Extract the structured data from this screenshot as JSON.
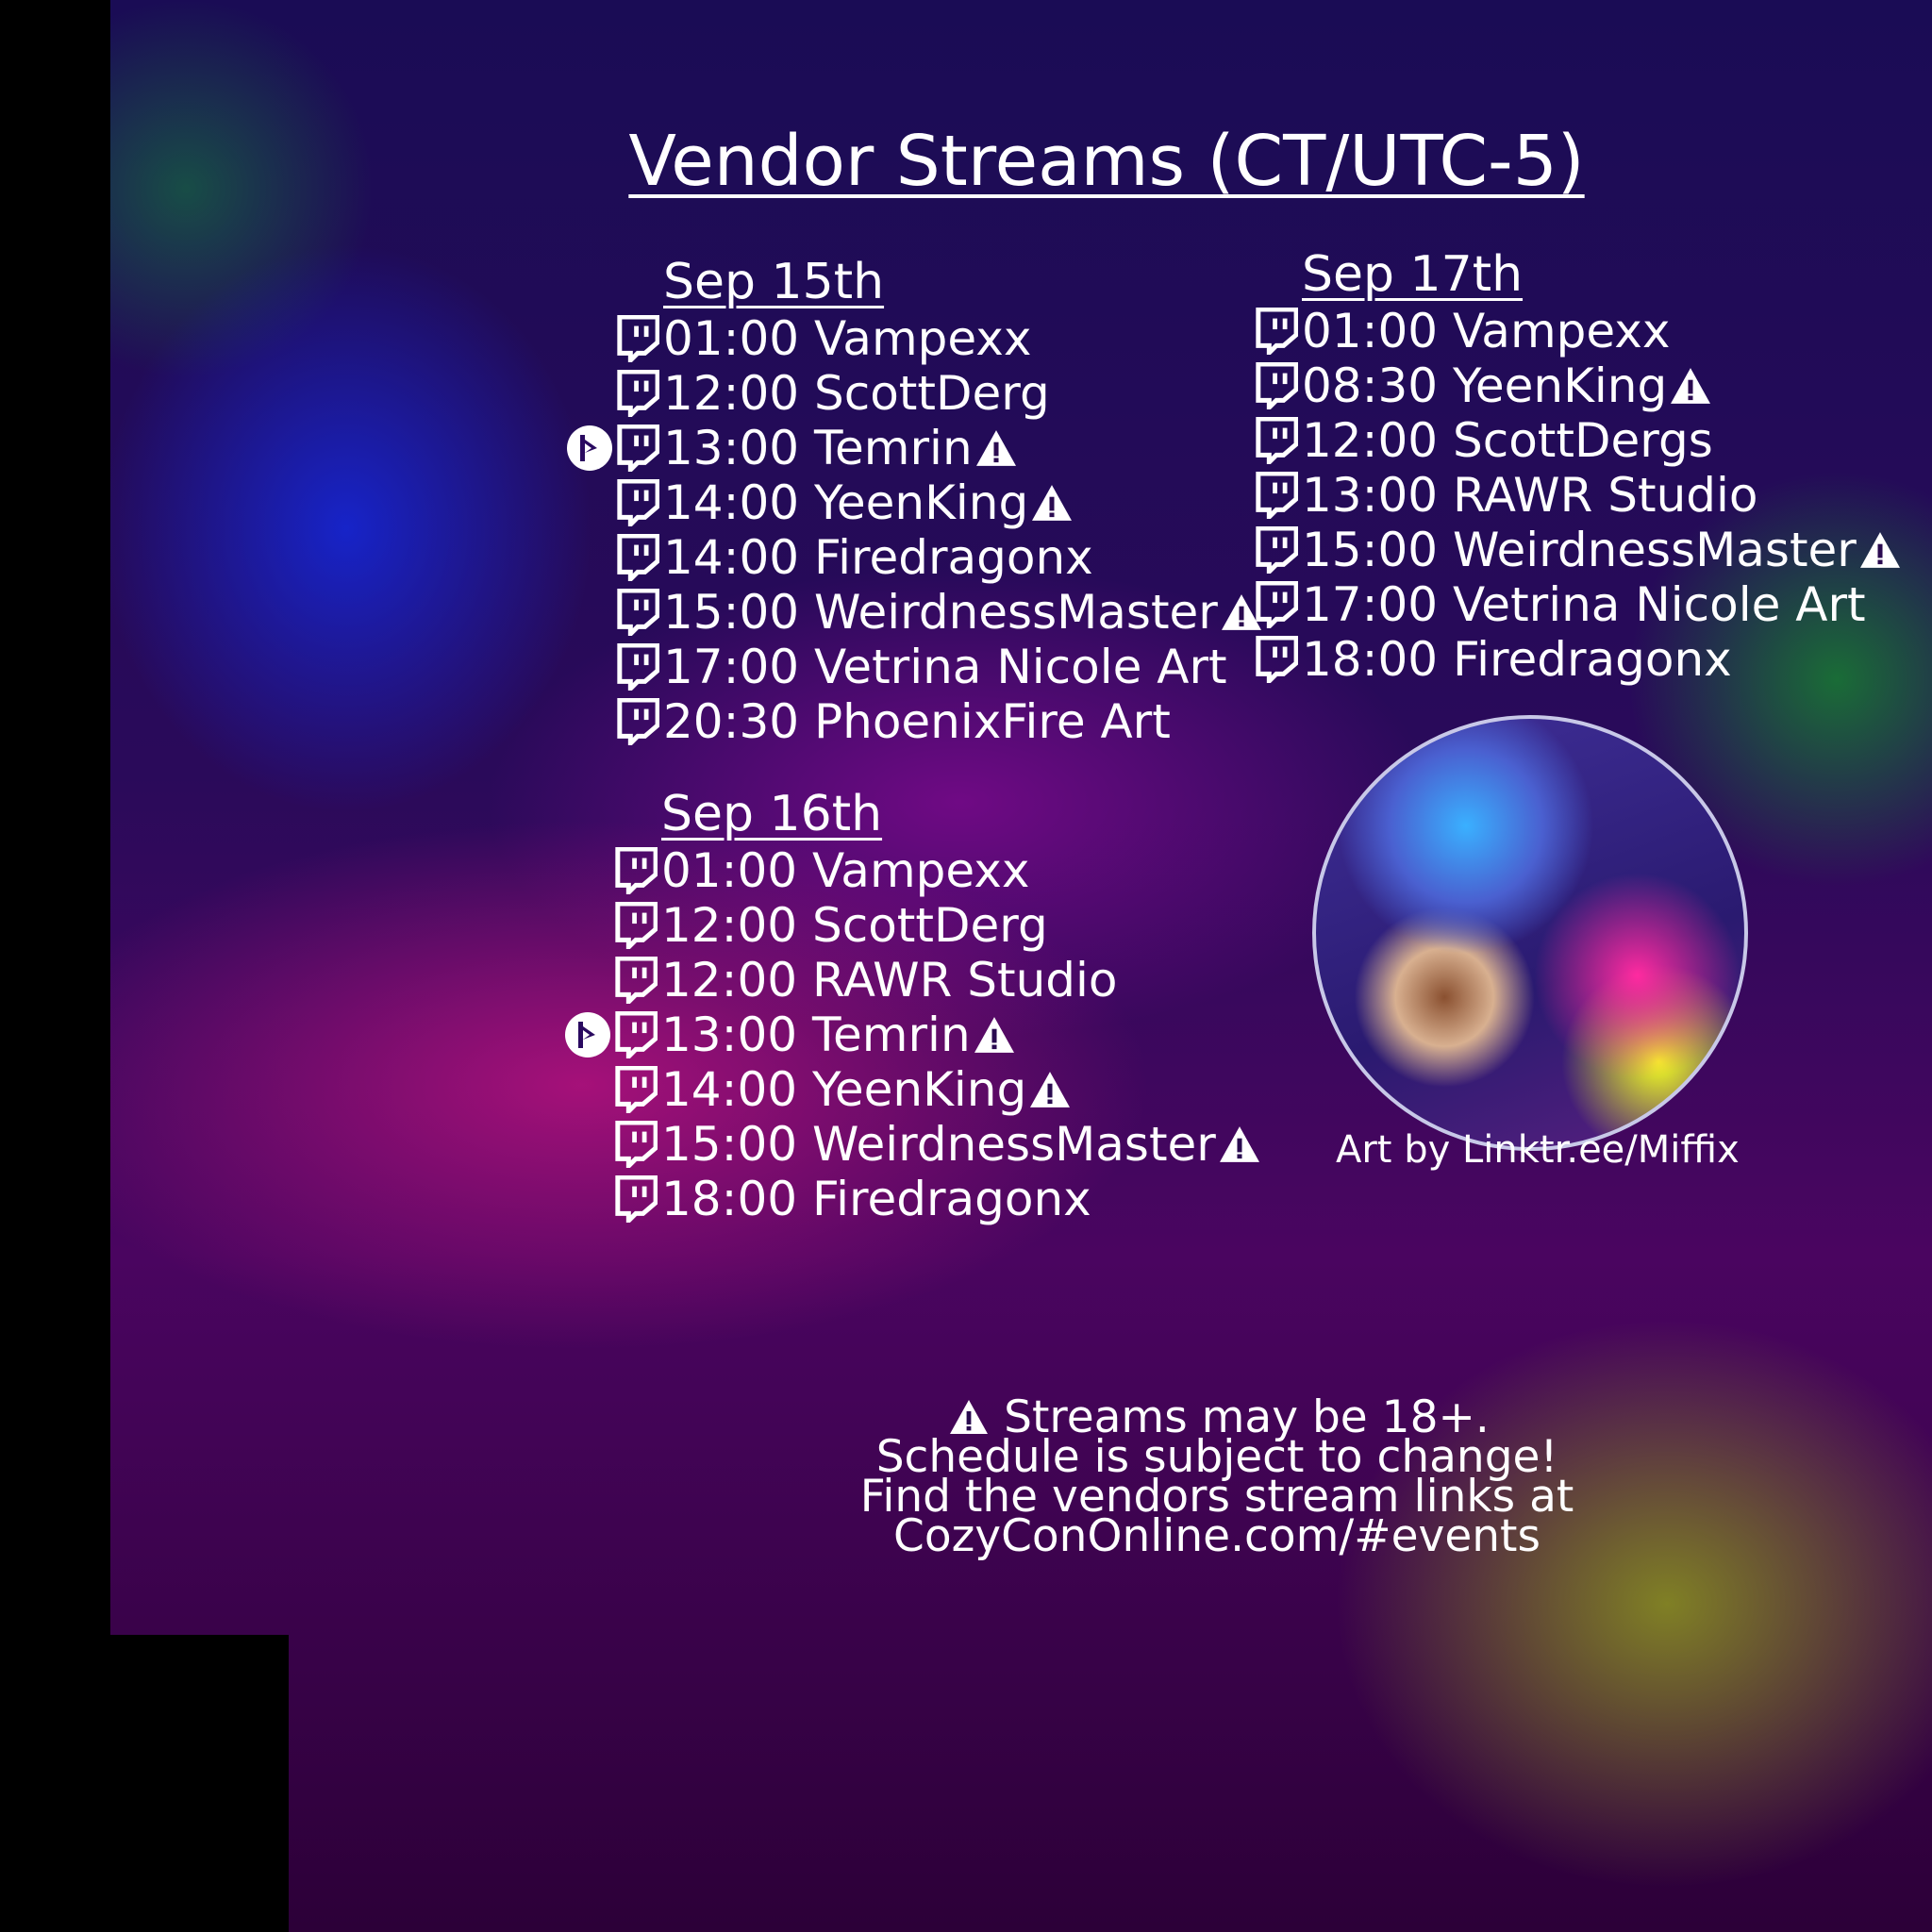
{
  "title": "Vendor Streams (CT/UTC-5)",
  "days": [
    {
      "label": "Sep 15th",
      "items": [
        {
          "text": "01:00 Vampexx",
          "warn": false,
          "play": false
        },
        {
          "text": "12:00 ScottDerg",
          "warn": false,
          "play": false
        },
        {
          "text": "13:00 Temrin",
          "warn": true,
          "play": true
        },
        {
          "text": "14:00 YeenKing",
          "warn": true,
          "play": false
        },
        {
          "text": "14:00 Firedragonx",
          "warn": false,
          "play": false
        },
        {
          "text": "15:00 WeirdnessMaster",
          "warn": true,
          "play": false
        },
        {
          "text": "17:00 Vetrina Nicole Art",
          "warn": false,
          "play": false
        },
        {
          "text": "20:30 PhoenixFire Art",
          "warn": false,
          "play": false
        }
      ]
    },
    {
      "label": "Sep 16th",
      "items": [
        {
          "text": "01:00 Vampexx",
          "warn": false,
          "play": false
        },
        {
          "text": "12:00 ScottDerg",
          "warn": false,
          "play": false
        },
        {
          "text": "12:00 RAWR Studio",
          "warn": false,
          "play": false
        },
        {
          "text": "13:00 Temrin",
          "warn": true,
          "play": true
        },
        {
          "text": "14:00 YeenKing",
          "warn": true,
          "play": false
        },
        {
          "text": "15:00 WeirdnessMaster",
          "warn": true,
          "play": false
        },
        {
          "text": "18:00 Firedragonx",
          "warn": false,
          "play": false
        }
      ]
    },
    {
      "label": "Sep 17th",
      "items": [
        {
          "text": "01:00 Vampexx",
          "warn": false,
          "play": false
        },
        {
          "text": "08:30 YeenKing",
          "warn": true,
          "play": false
        },
        {
          "text": "12:00 ScottDergs",
          "warn": false,
          "play": false
        },
        {
          "text": "13:00 RAWR Studio",
          "warn": false,
          "play": false
        },
        {
          "text": "15:00 WeirdnessMaster",
          "warn": true,
          "play": false
        },
        {
          "text": "17:00 Vetrina Nicole Art",
          "warn": false,
          "play": false
        },
        {
          "text": "18:00 Firedragonx",
          "warn": false,
          "play": false
        }
      ]
    }
  ],
  "art_caption": "Art by Linktr.ee/Miffix",
  "footer": [
    "Streams may be 18+.",
    "Schedule is subject to change!",
    "Find the vendors stream links at",
    "CozyConOnline.com/#events"
  ]
}
